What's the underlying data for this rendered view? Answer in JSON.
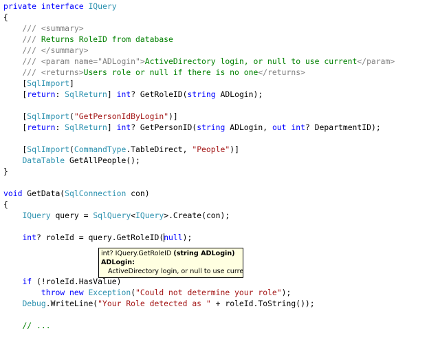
{
  "editor": {
    "lines": [
      [
        [
          "kw",
          "private interface "
        ],
        [
          "ty",
          "IQuery"
        ]
      ],
      [
        [
          "pl",
          "{"
        ]
      ],
      [
        [
          "pl",
          "    "
        ],
        [
          "xd",
          "/// <summary>"
        ]
      ],
      [
        [
          "pl",
          "    "
        ],
        [
          "xd",
          "/// "
        ],
        [
          "cm",
          "Returns RoleID from database"
        ]
      ],
      [
        [
          "pl",
          "    "
        ],
        [
          "xd",
          "/// </summary>"
        ]
      ],
      [
        [
          "pl",
          "    "
        ],
        [
          "xd",
          "/// <param name=\"ADLogin\">"
        ],
        [
          "cm",
          "ActiveDirectory login, or null to use current"
        ],
        [
          "xd",
          "</param>"
        ]
      ],
      [
        [
          "pl",
          "    "
        ],
        [
          "xd",
          "/// <returns>"
        ],
        [
          "cm",
          "Users role or null if there is no one"
        ],
        [
          "xd",
          "</returns>"
        ]
      ],
      [
        [
          "pl",
          "    ["
        ],
        [
          "ty",
          "SqlImport"
        ],
        [
          "pl",
          "]"
        ]
      ],
      [
        [
          "pl",
          "    ["
        ],
        [
          "kw",
          "return"
        ],
        [
          "pl",
          ": "
        ],
        [
          "ty",
          "SqlReturn"
        ],
        [
          "pl",
          "] "
        ],
        [
          "kw",
          "int"
        ],
        [
          "pl",
          "? GetRoleID("
        ],
        [
          "kw",
          "string"
        ],
        [
          "pl",
          " ADLogin);"
        ]
      ],
      [],
      [
        [
          "pl",
          "    ["
        ],
        [
          "ty",
          "SqlImport"
        ],
        [
          "pl",
          "("
        ],
        [
          "st",
          "\"GetPersonIdByLogin\""
        ],
        [
          "pl",
          ")]"
        ]
      ],
      [
        [
          "pl",
          "    ["
        ],
        [
          "kw",
          "return"
        ],
        [
          "pl",
          ": "
        ],
        [
          "ty",
          "SqlReturn"
        ],
        [
          "pl",
          "] "
        ],
        [
          "kw",
          "int"
        ],
        [
          "pl",
          "? GetPersonID("
        ],
        [
          "kw",
          "string"
        ],
        [
          "pl",
          " ADLogin, "
        ],
        [
          "kw",
          "out int"
        ],
        [
          "pl",
          "? DepartmentID);"
        ]
      ],
      [],
      [
        [
          "pl",
          "    ["
        ],
        [
          "ty",
          "SqlImport"
        ],
        [
          "pl",
          "("
        ],
        [
          "ty",
          "CommandType"
        ],
        [
          "pl",
          ".TableDirect, "
        ],
        [
          "st",
          "\"People\""
        ],
        [
          "pl",
          ")]"
        ]
      ],
      [
        [
          "pl",
          "    "
        ],
        [
          "ty",
          "DataTable"
        ],
        [
          "pl",
          " GetAllPeople();"
        ]
      ],
      [
        [
          "pl",
          "}"
        ]
      ],
      [],
      [
        [
          "kw",
          "void"
        ],
        [
          "pl",
          " GetData("
        ],
        [
          "ty",
          "SqlConnection"
        ],
        [
          "pl",
          " con)"
        ]
      ],
      [
        [
          "pl",
          "{"
        ]
      ],
      [
        [
          "pl",
          "    "
        ],
        [
          "ty",
          "IQuery"
        ],
        [
          "pl",
          " query = "
        ],
        [
          "ty",
          "SqlQuery"
        ],
        [
          "pl",
          "<"
        ],
        [
          "ty",
          "IQuery"
        ],
        [
          "pl",
          ">.Create(con);"
        ]
      ],
      [],
      [
        [
          "pl",
          "    "
        ],
        [
          "kw",
          "int"
        ],
        [
          "pl",
          "? roleId = query.GetRoleID("
        ],
        [
          "caret",
          ""
        ],
        [
          "kw",
          "null"
        ],
        [
          "pl",
          ");"
        ]
      ],
      [],
      [],
      [],
      [
        [
          "pl",
          "    "
        ],
        [
          "kw",
          "if"
        ],
        [
          "pl",
          " (!roleId.HasValue)"
        ]
      ],
      [
        [
          "pl",
          "        "
        ],
        [
          "kw",
          "throw new "
        ],
        [
          "ty",
          "Exception"
        ],
        [
          "pl",
          "("
        ],
        [
          "st",
          "\"Could not determine your role\""
        ],
        [
          "pl",
          ");"
        ]
      ],
      [
        [
          "pl",
          "    "
        ],
        [
          "ty",
          "Debug"
        ],
        [
          "pl",
          ".WriteLine("
        ],
        [
          "st",
          "\"Your Role detected as \""
        ],
        [
          "pl",
          " + roleId.ToString());"
        ]
      ],
      [],
      [
        [
          "pl",
          "    "
        ],
        [
          "cm",
          "// ..."
        ]
      ]
    ]
  },
  "tooltip": {
    "signature_prefix": "int? IQuery.GetRoleID ",
    "signature_param": "(string ADLogin)",
    "param_name": "ADLogin:",
    "param_description": "ActiveDirectory login, or null to use current"
  }
}
